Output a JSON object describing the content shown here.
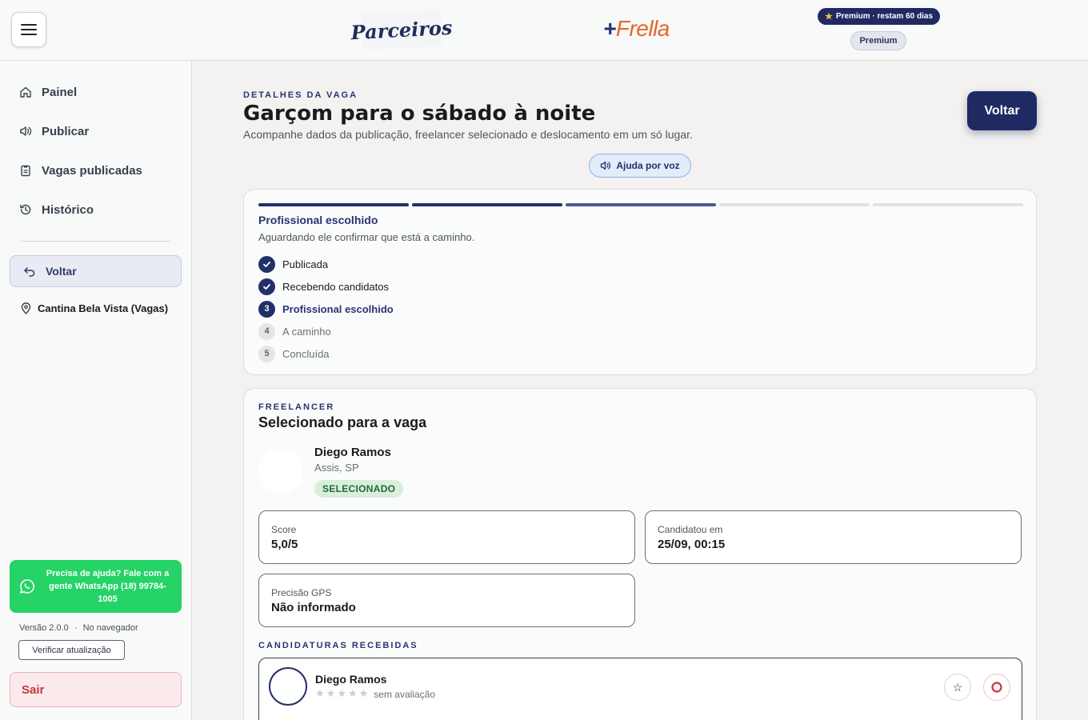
{
  "header": {
    "logo_parceiros": "Parceiros",
    "logo_frella_plus": "+",
    "logo_frella": "Frella",
    "premium_pill": "Premium · restam 60 dias",
    "premium_badge": "Premium"
  },
  "sidebar": {
    "items": [
      {
        "label": "Painel",
        "icon": "home-icon"
      },
      {
        "label": "Publicar",
        "icon": "megaphone-icon"
      },
      {
        "label": "Vagas publicadas",
        "icon": "clipboard-icon"
      },
      {
        "label": "Histórico",
        "icon": "history-icon"
      }
    ],
    "voltar": "Voltar",
    "place": "Cantina Bela Vista (Vagas)",
    "help": "Precisa de ajuda? Fale com a gente WhatsApp (18) 99784-1005",
    "version": "Versão 2.0.0",
    "version_sep": "·",
    "version_mode": "No navegador",
    "check_update": "Verificar atualização",
    "logout": "Sair"
  },
  "main": {
    "eyebrow": "DETALHES DA VAGA",
    "title": "Garçom para o sábado à noite",
    "subtitle": "Acompanhe dados da publicação, freelancer selecionado e deslocamento em um só lugar.",
    "back": "Voltar",
    "voice_help": "Ajuda por voz"
  },
  "status": {
    "progress_completed_segments": 3,
    "progress_total_segments": 5,
    "title": "Profissional escolhido",
    "subtitle": "Aguardando ele confirmar que está a caminho.",
    "steps": [
      {
        "num": "1",
        "label": "Publicada",
        "state": "done"
      },
      {
        "num": "2",
        "label": "Recebendo candidatos",
        "state": "done"
      },
      {
        "num": "3",
        "label": "Profissional escolhido",
        "state": "current"
      },
      {
        "num": "4",
        "label": "A caminho",
        "state": "todo"
      },
      {
        "num": "5",
        "label": "Concluída",
        "state": "todo"
      }
    ]
  },
  "freelancer": {
    "eyebrow": "FREELANCER",
    "title": "Selecionado para a vaga",
    "name": "Diego Ramos",
    "city": "Assis, SP",
    "badge": "SELECIONADO",
    "stats": [
      {
        "label": "Score",
        "value": "5,0/5"
      },
      {
        "label": "Candidatou em",
        "value": "25/09, 00:15"
      },
      {
        "label": "Precisão GPS",
        "value": "Não informado"
      }
    ]
  },
  "candidaturas": {
    "eyebrow": "CANDIDATURAS RECEBIDAS",
    "items": [
      {
        "name": "Diego Ramos",
        "rating": 0,
        "rating_label": "sem avaliação"
      }
    ]
  },
  "colors": {
    "navy": "#1f2a63",
    "frella_orange": "#e8652a",
    "whatsapp_green": "#25d366",
    "danger_red": "#c9353f",
    "selected_green": "#1d6b36"
  }
}
